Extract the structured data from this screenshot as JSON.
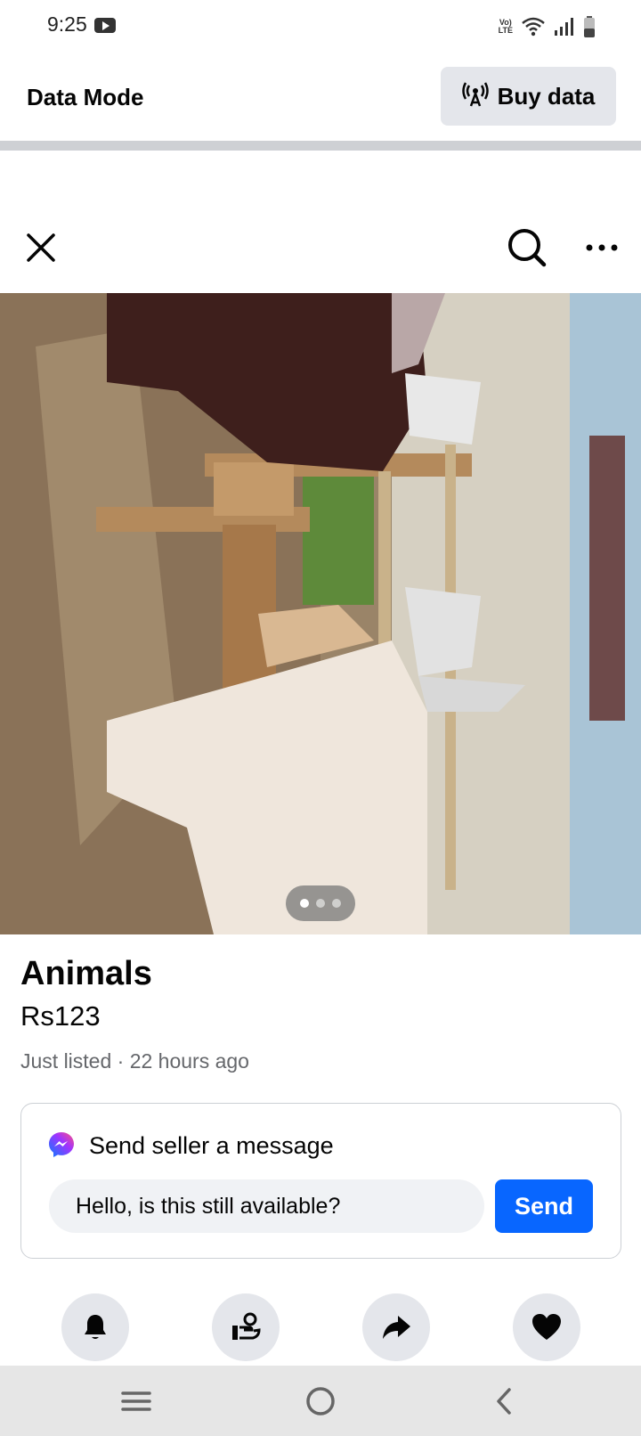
{
  "status_bar": {
    "time": "9:25",
    "network_badge": "VoLTE",
    "icons": [
      "youtube-icon",
      "wifi-icon",
      "signal-icon",
      "battery-icon"
    ]
  },
  "data_mode": {
    "title": "Data Mode",
    "buy_label": "Buy data",
    "buy_icon": "antenna-icon"
  },
  "viewer": {
    "icons": [
      "close-icon",
      "search-icon",
      "more-icon"
    ],
    "photo_pages": 3,
    "active_page": 1
  },
  "listing": {
    "title": "Animals",
    "price": "Rs123",
    "meta": "Just listed · 22 hours ago"
  },
  "message": {
    "heading": "Send seller a message",
    "input_value": "Hello, is this still available?",
    "send_label": "Send",
    "icon": "messenger-icon"
  },
  "actions": [
    "bell-icon",
    "seller-icon",
    "share-icon",
    "heart-icon"
  ],
  "system_nav": [
    "recents-icon",
    "home-icon",
    "back-icon"
  ],
  "colors": {
    "accent": "#0866ff",
    "button_bg": "#e4e6eb",
    "input_bg": "#f0f2f5",
    "secondary_text": "#65676b"
  }
}
